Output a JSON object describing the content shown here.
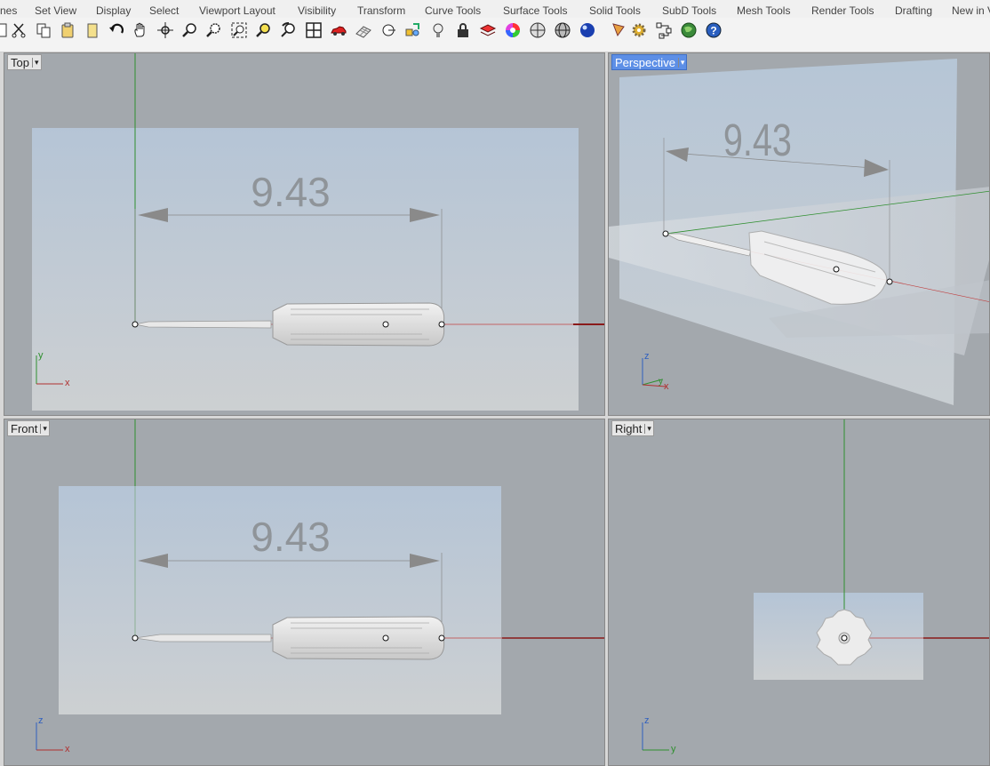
{
  "menu_tabs": [
    "nes",
    "Set View",
    "Display",
    "Select",
    "Viewport Layout",
    "Visibility",
    "Transform",
    "Curve Tools",
    "Surface Tools",
    "Solid Tools",
    "SubD Tools",
    "Mesh Tools",
    "Render Tools",
    "Drafting",
    "New in V"
  ],
  "toolbar_icons": [
    "new-file-icon",
    "cut-icon",
    "copy-icon",
    "paste-icon",
    "undo-icon",
    "pan-hand-icon",
    "rotate-view-icon",
    "zoom-icon",
    "zoom-window-icon",
    "zoom-extents-icon",
    "zoom-selected-icon",
    "rotate-camera-icon",
    "four-viewports-icon",
    "car-icon",
    "grid-plane-icon",
    "point-snap-icon",
    "object-snap-icon",
    "light-bulb-icon",
    "lock-icon",
    "layer-icon",
    "color-wheel-icon",
    "shaded-sphere-icon",
    "mesh-sphere-icon",
    "render-sphere-icon",
    "pen-icon",
    "settings-gear-icon",
    "network-icon",
    "globe-icon",
    "help-icon"
  ],
  "viewports": {
    "top": {
      "label": "Top",
      "dimension": "9.43",
      "axis_x": "x",
      "axis_y": "y"
    },
    "perspective": {
      "label": "Perspective",
      "dimension": "9.43",
      "axis_x": "x",
      "axis_y": "y",
      "axis_z": "z"
    },
    "front": {
      "label": "Front",
      "dimension": "9.43",
      "axis_x": "x",
      "axis_z": "z"
    },
    "right": {
      "label": "Right",
      "axis_y": "y",
      "axis_z": "z"
    }
  },
  "active_viewport": "Perspective",
  "colors": {
    "viewport_bg": "#a3a8ad",
    "active_label": "#5d8fe6",
    "x_axis": "#b03030",
    "y_axis": "#2f8f2f"
  }
}
